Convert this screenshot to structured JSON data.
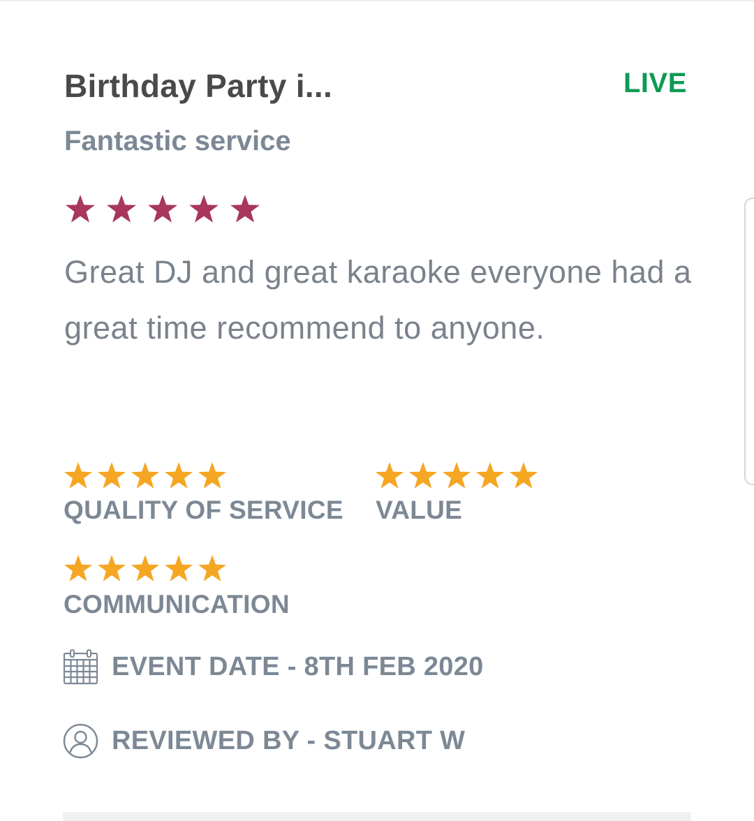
{
  "review": {
    "title": "Birthday Party i...",
    "status": "LIVE",
    "headline": "Fantastic service",
    "overall_rating": 5,
    "overall_rating_max": 5,
    "body": "Great DJ and great karaoke everyone had a great time recommend to anyone.",
    "categories": {
      "quality_of_service": {
        "label": "QUALITY OF SERVICE",
        "rating": 5
      },
      "value": {
        "label": "VALUE",
        "rating": 5
      },
      "communication": {
        "label": "COMMUNICATION",
        "rating": 5
      }
    },
    "event_date": "EVENT DATE - 8TH FEB 2020",
    "reviewed_by": "REVIEWED BY - STUART W"
  },
  "icons": {
    "overall_star": "star-icon",
    "category_star": "star-icon",
    "date": "calendar-icon",
    "reviewer": "user-circle-icon"
  },
  "colors": {
    "title": "#4a4a4a",
    "status_live": "#0e9a54",
    "muted_text": "#7d8895",
    "overall_star": "#a8365f",
    "category_star": "#f5a623"
  }
}
